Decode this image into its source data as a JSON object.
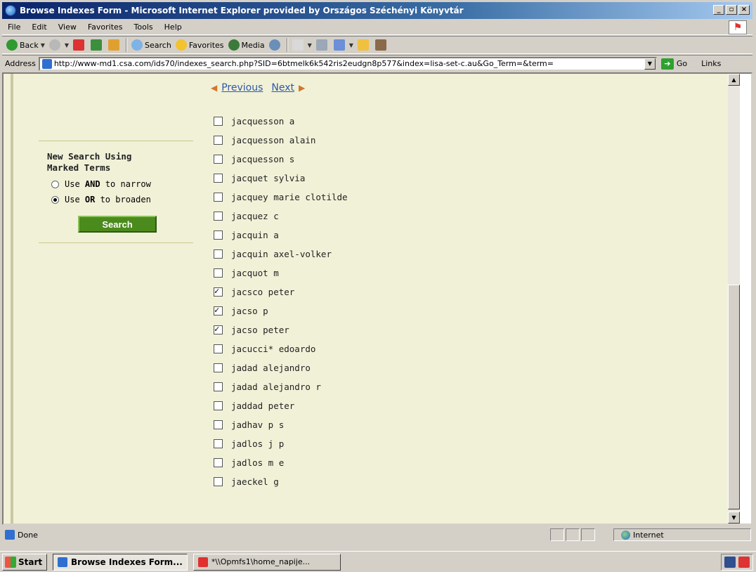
{
  "window": {
    "title": "Browse Indexes Form - Microsoft Internet Explorer provided by Országos Széchényi Könyvtár",
    "controls": [
      "_",
      "▫",
      "×"
    ]
  },
  "menu": [
    "File",
    "Edit",
    "View",
    "Favorites",
    "Tools",
    "Help"
  ],
  "toolbar": {
    "back_label": "Back",
    "search_label": "Search",
    "favorites_label": "Favorites",
    "media_label": "Media"
  },
  "address": {
    "label": "Address",
    "url": "http://www-md1.csa.com/ids70/indexes_search.php?SID=6btmelk6k542ris2eudgn8p577&index=lisa-set-c.au&Go_Term=&term=",
    "go_label": "Go",
    "links_label": "Links"
  },
  "pager": {
    "previous_label": "Previous",
    "next_label": "Next"
  },
  "search_panel": {
    "title_line1": "New Search Using",
    "title_line2": "Marked Terms",
    "option_and_prefix": "Use ",
    "option_and_bold": "AND",
    "option_and_suffix": " to narrow",
    "option_or_prefix": "Use ",
    "option_or_bold": "OR",
    "option_or_suffix": " to broaden",
    "selected_option": "or",
    "search_button": "Search"
  },
  "terms": [
    {
      "label": "jacquesson a",
      "checked": false
    },
    {
      "label": "jacquesson alain",
      "checked": false
    },
    {
      "label": "jacquesson s",
      "checked": false
    },
    {
      "label": "jacquet sylvia",
      "checked": false
    },
    {
      "label": "jacquey marie clotilde",
      "checked": false
    },
    {
      "label": "jacquez c",
      "checked": false
    },
    {
      "label": "jacquin a",
      "checked": false
    },
    {
      "label": "jacquin axel-volker",
      "checked": false
    },
    {
      "label": "jacquot m",
      "checked": false
    },
    {
      "label": "jacsco peter",
      "checked": true
    },
    {
      "label": "jacso p",
      "checked": true
    },
    {
      "label": "jacso peter",
      "checked": true
    },
    {
      "label": "jacucci* edoardo",
      "checked": false
    },
    {
      "label": "jadad alejandro",
      "checked": false
    },
    {
      "label": "jadad alejandro r",
      "checked": false
    },
    {
      "label": "jaddad peter",
      "checked": false
    },
    {
      "label": "jadhav p s",
      "checked": false
    },
    {
      "label": "jadlos j p",
      "checked": false
    },
    {
      "label": "jadlos m e",
      "checked": false
    },
    {
      "label": "jaeckel g",
      "checked": false
    }
  ],
  "status": {
    "text": "Done",
    "zone": "Internet"
  },
  "taskbar": {
    "start_label": "Start",
    "tasks": [
      {
        "label": "Browse Indexes Form...",
        "active": true
      },
      {
        "label": "*\\\\Opmfs1\\home_napije...",
        "active": false
      }
    ]
  }
}
